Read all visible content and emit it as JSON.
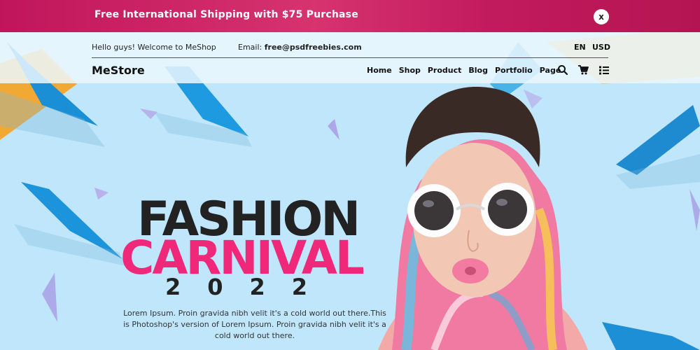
{
  "promo": {
    "text": "Free International Shipping with $75 Purchase",
    "close_label": "x"
  },
  "header": {
    "welcome": "Hello guys! Welcome to MeShop",
    "email_label": "Email: ",
    "email_value": "free@psdfreebies.com",
    "language": "EN",
    "currency": "USD",
    "logo": "MeStore",
    "nav": [
      "Home",
      "Shop",
      "Product",
      "Blog",
      "Portfolio",
      "Page"
    ],
    "icons": [
      "search-icon",
      "cart-icon",
      "menu-list-icon"
    ]
  },
  "hero": {
    "title_line1": "FASHION",
    "title_line2": "CARNIVAL",
    "year": "2022",
    "body": "Lorem Ipsum. Proin gravida nibh velit it's a cold world out there.This is Photoshop's version of Lorem Ipsum. Proin gravida nibh velit it's a cold world out there."
  },
  "colors": {
    "promo_bg": "#c0155b",
    "accent_pink": "#f0287a",
    "hero_bg": "#bfe6fb",
    "dark_text": "#222222"
  }
}
